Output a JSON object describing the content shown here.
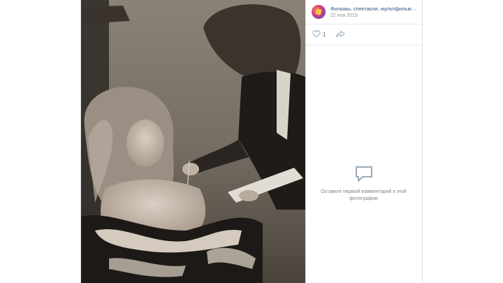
{
  "post": {
    "title": "Фильмы, спектакли, мультфильмы...",
    "date": "22 ноя 2015"
  },
  "actions": {
    "like_count": "1"
  },
  "comments": {
    "empty_text": "Оставьте первый комментарий к этой фотографии"
  },
  "icons": {
    "avatar": "community-avatar-icon",
    "like": "heart-icon",
    "share": "share-arrow-icon",
    "comment": "comment-bubble-icon"
  },
  "colors": {
    "link": "#2a5885",
    "muted": "#939393",
    "icon": "#8fa1b3"
  }
}
